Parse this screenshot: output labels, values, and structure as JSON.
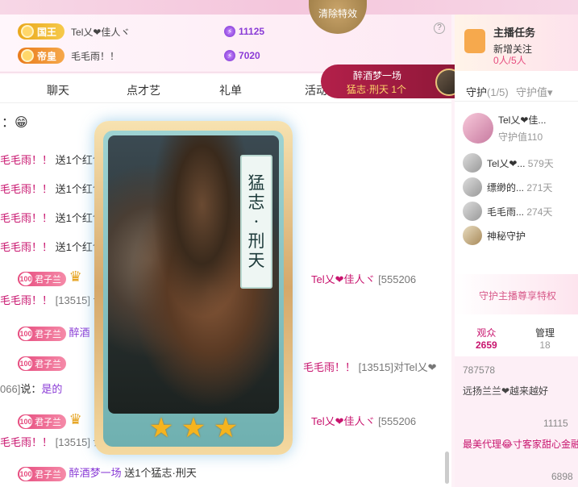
{
  "top_effect": {
    "label": "清除特效"
  },
  "rank": {
    "help": "?",
    "rows": [
      {
        "badge": "国王",
        "name": "Tel乂❤佳人ヾ",
        "coins": "11125"
      },
      {
        "badge": "帝皇",
        "name": "毛毛雨！！",
        "coins": "7020"
      }
    ]
  },
  "tabs": [
    "聊天",
    "点才艺",
    "礼单",
    "活动"
  ],
  "chat": {
    "lines": [
      {
        "text": "：😁"
      },
      {
        "name": "毛毛雨！！",
        "text": "送1个红包"
      },
      {
        "name": "毛毛雨！！",
        "text": "送1个红包"
      },
      {
        "name": "毛毛雨！！",
        "text": "送1个红包"
      },
      {
        "name": "毛毛雨！！",
        "text": "送1个红包"
      }
    ],
    "level": "100",
    "guard_badge": "君子兰",
    "l6_name": "Tel乂❤佳人ヾ",
    "l6_id": "[555206",
    "l7_prefix": "毛毛雨！！",
    "l7_id": "[13515]",
    "l7_say": "说：",
    "l8_name_prefix": "醉酒",
    "l9_mid": "毛毛雨！！",
    "l9_id": "[13515]对Tel乂❤",
    "l10_prefix": "066]",
    "l10_say": "说：",
    "l10_text": "是的",
    "l11_name": "Tel乂❤佳人ヾ",
    "l11_id": "[555206",
    "l12_prefix": "毛毛雨！！",
    "l12_id": "[13515]",
    "l12_say": "说：",
    "last_name": "醉酒梦一场",
    "last_text": "送1个猛志·刑天"
  },
  "toast": {
    "sender": "醉酒梦一场",
    "gift": "猛志·刑天",
    "count": "1个"
  },
  "card": {
    "title_chars": [
      "猛",
      "志",
      "·",
      "刑",
      "天"
    ]
  },
  "task": {
    "title": "主播任务",
    "sub": "新增关注",
    "progress": "0人/5人"
  },
  "guard": {
    "tab": "守护",
    "count": "(1/5)",
    "value_tab": "守护值▾",
    "top": {
      "name": "Tel乂❤佳...",
      "value": "守护值110"
    },
    "list": [
      {
        "name": "Tel乂❤...",
        "days": "579天"
      },
      {
        "name": "缥缈的...",
        "days": "271天"
      },
      {
        "name": "毛毛雨...",
        "days": "274天"
      },
      {
        "name": "神秘守护",
        "days": ""
      }
    ],
    "privilege": "守护主播尊享特权"
  },
  "viewers": {
    "tab_viewers": "观众",
    "viewers_count": "2659",
    "tab_admin": "管理",
    "admin_count": "18",
    "entries": [
      {
        "text": "787578"
      },
      {
        "text": "远扬兰兰❤越来越好"
      },
      {
        "text": "11115"
      },
      {
        "text": "最美代理😂寸客家甜心金融"
      },
      {
        "text": "6898"
      }
    ]
  },
  "colors": {
    "accent": "#c8146e",
    "purple": "#8a3bd6"
  }
}
